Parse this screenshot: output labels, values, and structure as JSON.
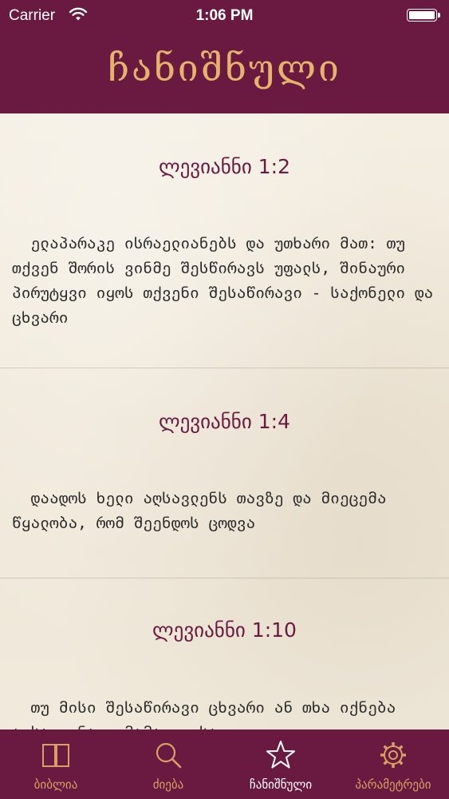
{
  "status_bar": {
    "carrier": "Carrier",
    "time": "1:06 PM",
    "battery_level": 1.0
  },
  "nav": {
    "title": "ჩანიშნული"
  },
  "entries": [
    {
      "reference": "ლევიანნი 1:2",
      "text": "  ელაპარაკე ისრაელიანებს და უთხარი მათ: თუ თქვენ შორის ვინმე შესწირავს უფალს, შინაური პირუტყვი იყოს თქვენი შესაწირავი - საქონელი და ცხვარი"
    },
    {
      "reference": "ლევიანნი 1:4",
      "text": "  დაადოს ხელი აღსავლენს თავზე და მიეცემა წყალობა, რომ შეენდოს ცოდვა"
    },
    {
      "reference": "ლევიანნი 1:10",
      "text": "  თუ მისი შესაწირავი ცხვარი ან თხა იქნება აღსავლენად, მამალი, საღი"
    }
  ],
  "tabs": [
    {
      "label": "ბიბლია",
      "icon": "book-icon"
    },
    {
      "label": "ძიება",
      "icon": "search-icon"
    },
    {
      "label": "ჩანიშნული",
      "icon": "star-icon",
      "selected": true
    },
    {
      "label": "პარამეტრები",
      "icon": "gear-icon"
    }
  ],
  "colors": {
    "brand": "#6a1a40",
    "title": "#e6b36b",
    "tab_inactive": "#d9a062",
    "tab_active": "#ffffff",
    "paper": "#f2ece0"
  }
}
